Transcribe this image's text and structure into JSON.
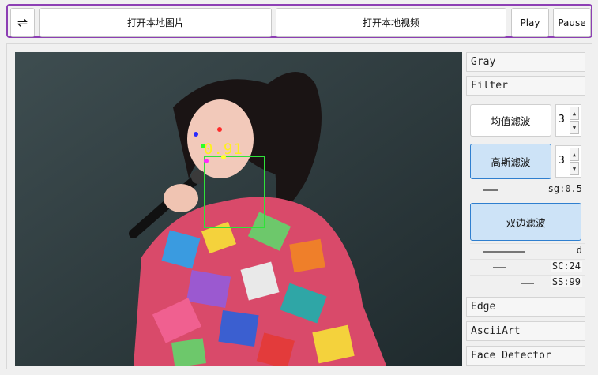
{
  "toolbar": {
    "swap_icon": "⇌",
    "open_image_label": "打开本地图片",
    "open_video_label": "打开本地视频",
    "play_label": "Play",
    "pause_label": "Pause"
  },
  "viewer": {
    "confidence": "0.91",
    "box_color": "#2ee23a",
    "confidence_color": "#ffef1f",
    "landmark_colors": [
      "#2a2aff",
      "#ff2a2a",
      "#2aff2a",
      "#ff2aff",
      "#ffff2a"
    ]
  },
  "sidebar": {
    "sections": {
      "gray": "Gray",
      "filter": "Filter",
      "edge": "Edge",
      "ascii": "AsciiArt",
      "face": "Face Detector"
    },
    "filter": {
      "mean_label": "均值滤波",
      "mean_value": "3",
      "gauss_label": "高斯滤波",
      "gauss_value": "3",
      "sigma_label": "sg:0.5",
      "bilateral_label": "双边滤波",
      "d_label": "d",
      "sc_label": "SC:24",
      "ss_label": "SS:99"
    },
    "spin_up": "▲",
    "spin_down": "▼"
  }
}
